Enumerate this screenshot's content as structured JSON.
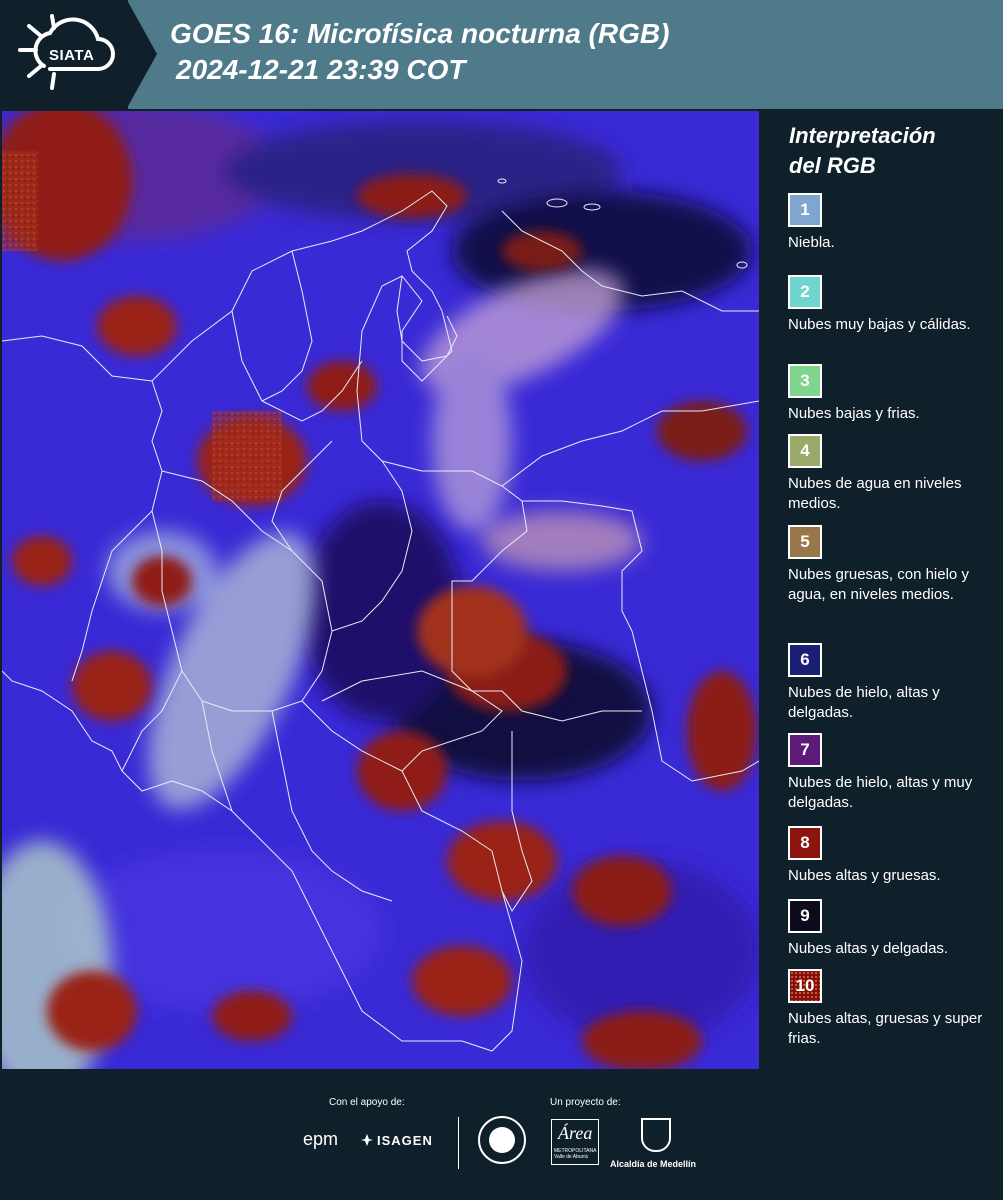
{
  "brand": {
    "logo_text": "SIATA"
  },
  "header": {
    "title_line1": "GOES 16: Microfísica nocturna (RGB)",
    "title_line2": "2024-12-21 23:39 COT"
  },
  "legend": {
    "title_line1": "Interpretación",
    "title_line2": "del RGB",
    "items": [
      {
        "number": "1",
        "label": "Niebla.",
        "color": "#7fa6cf"
      },
      {
        "number": "2",
        "label": "Nubes muy bajas y cálidas.",
        "color": "#6fd6cf"
      },
      {
        "number": "3",
        "label": "Nubes bajas y frias.",
        "color": "#7fd58c"
      },
      {
        "number": "4",
        "label": "Nubes de agua en niveles medios.",
        "color": "#9aa86a"
      },
      {
        "number": "5",
        "label": "Nubes gruesas, con hielo y agua, en niveles medios.",
        "color": "#98774a"
      },
      {
        "number": "6",
        "label": "Nubes de hielo, altas y delgadas.",
        "color": "#1b1f74"
      },
      {
        "number": "7",
        "label": "Nubes de hielo, altas y muy delgadas.",
        "color": "#5e1a7a"
      },
      {
        "number": "8",
        "label": "Nubes altas y gruesas.",
        "color": "#8c1510"
      },
      {
        "number": "9",
        "label": "Nubes altas y delgadas.",
        "color": "#0e0b1f"
      },
      {
        "number": "10",
        "label": "Nubes altas, gruesas y super frias.",
        "color": "#7a120c"
      }
    ]
  },
  "footer": {
    "support_label": "Con el apoyo de:",
    "project_label": "Un proyecto de:",
    "sponsors": [
      "epm",
      "ISAGEN"
    ],
    "partners": {
      "area_logo_text": "Área",
      "area_logo_sub": "METROPOLITANA Valle de Aburrá",
      "medellin": "Alcaldía de Medellín"
    }
  }
}
